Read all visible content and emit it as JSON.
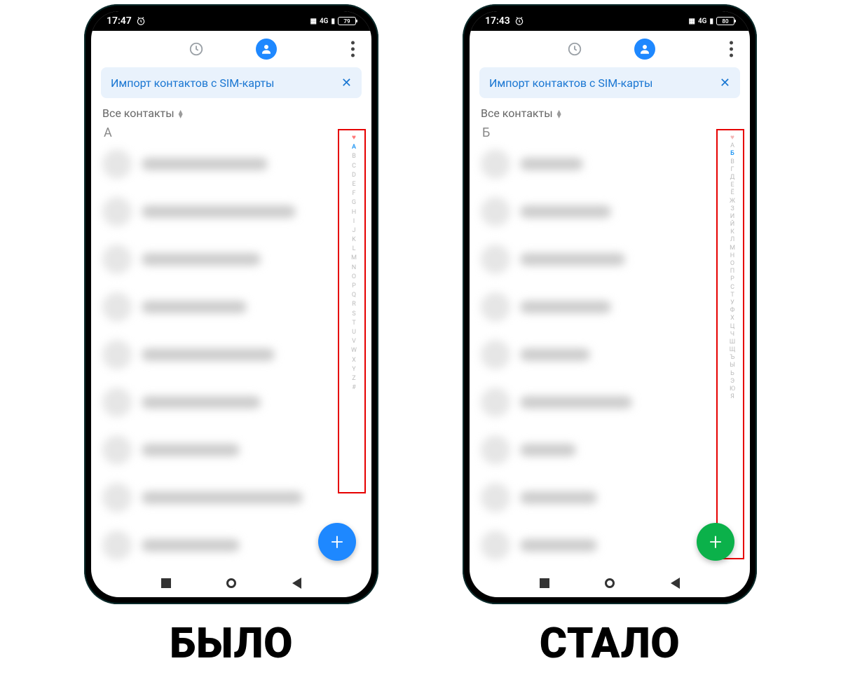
{
  "left": {
    "caption": "БЫЛО",
    "statusbar": {
      "time": "17:47",
      "battery": "79"
    },
    "banner": {
      "text": "Импорт контактов с SIM-карты",
      "close": "✕"
    },
    "filter": "Все контакты",
    "section_letter": "А",
    "index": [
      "A",
      "B",
      "C",
      "D",
      "E",
      "F",
      "G",
      "H",
      "I",
      "J",
      "K",
      "L",
      "M",
      "N",
      "O",
      "P",
      "Q",
      "R",
      "S",
      "T",
      "U",
      "V",
      "W",
      "X",
      "Y",
      "Z",
      "#"
    ],
    "index_active": "A",
    "contact_widths": [
      180,
      220,
      170,
      150,
      190,
      170,
      140,
      230,
      140
    ],
    "fab_color": "blue"
  },
  "right": {
    "caption": "СТАЛО",
    "statusbar": {
      "time": "17:43",
      "battery": "80"
    },
    "banner": {
      "text": "Импорт контактов с SIM-карты",
      "close": "✕"
    },
    "filter": "Все контакты",
    "section_letter": "Б",
    "index": [
      "А",
      "Б",
      "В",
      "Г",
      "Д",
      "Е",
      "Ё",
      "Ж",
      "З",
      "И",
      "Й",
      "К",
      "Л",
      "М",
      "Н",
      "О",
      "П",
      "Р",
      "С",
      "Т",
      "У",
      "Ф",
      "Х",
      "Ц",
      "Ч",
      "Ш",
      "Щ",
      "Ъ",
      "Ы",
      "Ь",
      "Э",
      "Ю",
      "Я"
    ],
    "index_active": "Б",
    "contact_widths": [
      90,
      130,
      150,
      130,
      100,
      160,
      80,
      110,
      110
    ],
    "fab_color": "green"
  }
}
